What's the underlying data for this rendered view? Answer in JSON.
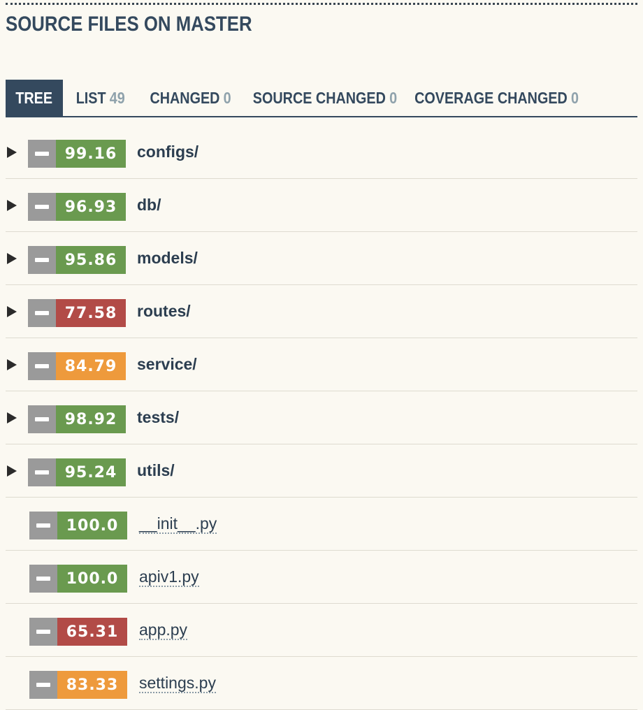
{
  "header": {
    "title": "SOURCE FILES ON MASTER"
  },
  "tabs": [
    {
      "label": "TREE",
      "count": null,
      "active": true
    },
    {
      "label": "LIST",
      "count": "49",
      "active": false
    },
    {
      "label": "CHANGED",
      "count": "0",
      "active": false
    },
    {
      "label": "SOURCE CHANGED",
      "count": "0",
      "active": false
    },
    {
      "label": "COVERAGE CHANGED",
      "count": "0",
      "active": false
    }
  ],
  "colors": {
    "green": "#6a9a4f",
    "red": "#b24b47",
    "orange": "#ee9a3c",
    "gray": "#9a9a9a",
    "accent": "#34495e"
  },
  "entries": [
    {
      "name": "configs/",
      "coverage": "99.16",
      "level": "green",
      "type": "dir"
    },
    {
      "name": "db/",
      "coverage": "96.93",
      "level": "green",
      "type": "dir"
    },
    {
      "name": "models/",
      "coverage": "95.86",
      "level": "green",
      "type": "dir"
    },
    {
      "name": "routes/",
      "coverage": "77.58",
      "level": "red",
      "type": "dir"
    },
    {
      "name": "service/",
      "coverage": "84.79",
      "level": "orange",
      "type": "dir"
    },
    {
      "name": "tests/",
      "coverage": "98.92",
      "level": "green",
      "type": "dir"
    },
    {
      "name": "utils/",
      "coverage": "95.24",
      "level": "green",
      "type": "dir"
    },
    {
      "name": "__init__.py",
      "coverage": "100.0",
      "level": "green",
      "type": "file"
    },
    {
      "name": "apiv1.py",
      "coverage": "100.0",
      "level": "green",
      "type": "file"
    },
    {
      "name": "app.py",
      "coverage": "65.31",
      "level": "red",
      "type": "file"
    },
    {
      "name": "settings.py",
      "coverage": "83.33",
      "level": "orange",
      "type": "file"
    }
  ]
}
